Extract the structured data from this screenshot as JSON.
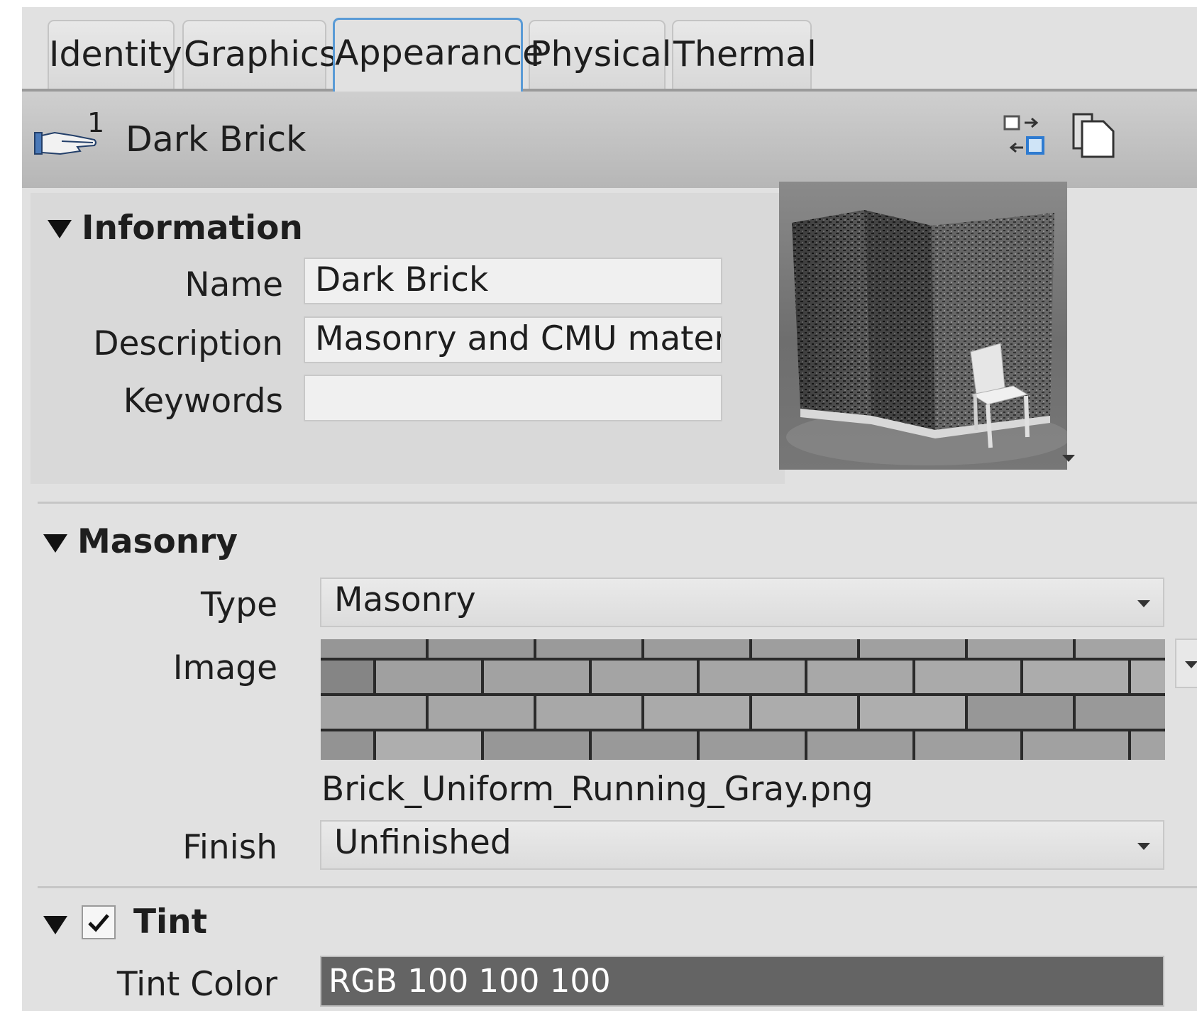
{
  "tabs": [
    {
      "label": "Identity"
    },
    {
      "label": "Graphics"
    },
    {
      "label": "Appearance",
      "active": true
    },
    {
      "label": "Physical"
    },
    {
      "label": "Thermal"
    }
  ],
  "header": {
    "number": "1",
    "title": "Dark Brick"
  },
  "information": {
    "title": "Information",
    "name_label": "Name",
    "name_value": "Dark Brick",
    "description_label": "Description",
    "description_value": "Masonry and CMU material.",
    "keywords_label": "Keywords",
    "keywords_value": ""
  },
  "masonry": {
    "title": "Masonry",
    "type_label": "Type",
    "type_value": "Masonry",
    "image_label": "Image",
    "image_filename": "Brick_Uniform_Running_Gray.png",
    "finish_label": "Finish",
    "finish_value": "Unfinished"
  },
  "tint": {
    "title": "Tint",
    "enabled": true,
    "color_label": "Tint Color",
    "color_value": "RGB 100 100 100",
    "color_hex": "#646464"
  }
}
